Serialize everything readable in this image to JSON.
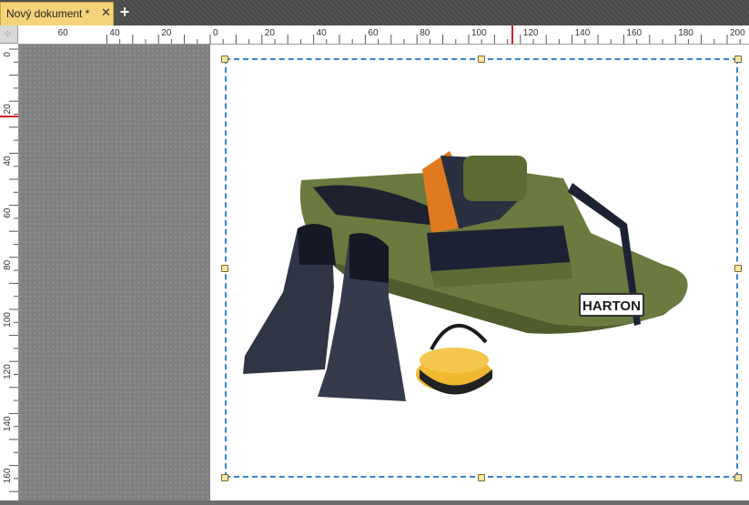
{
  "tab": {
    "label": "Nový dokument *",
    "close": "✕",
    "new_tab": "+"
  },
  "ruler": {
    "horizontal_labels": [
      "60",
      "40",
      "20",
      "0",
      "20",
      "40",
      "60",
      "80",
      "100",
      "120",
      "140",
      "160",
      "180",
      "200"
    ],
    "vertical_labels": [
      "0",
      "20",
      "40",
      "60",
      "80",
      "100",
      "120",
      "140",
      "160"
    ]
  },
  "image": {
    "description_icon": "float-tube-boat",
    "brand_text": "HARTON"
  },
  "colors": {
    "tab": "#f5d37a",
    "selection": "#3a82d6",
    "boat_green": "#6b7a3e"
  }
}
